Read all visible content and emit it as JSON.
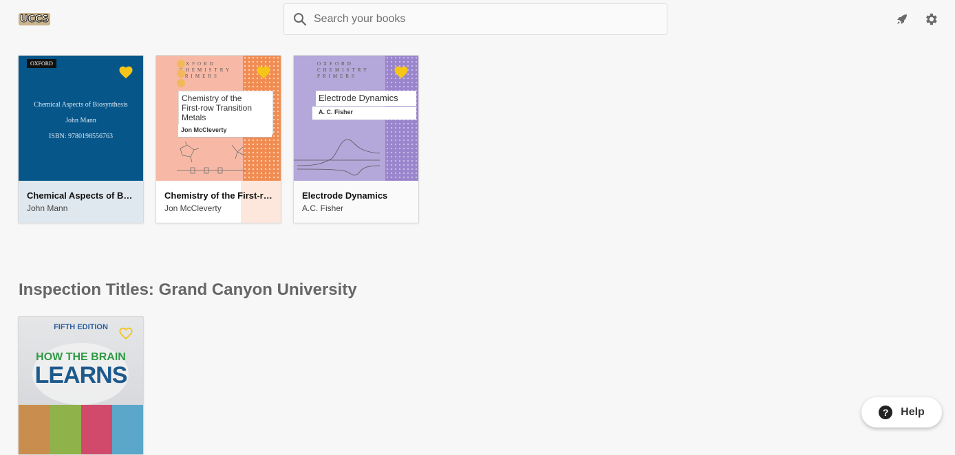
{
  "header": {
    "logo_text": "UCCS",
    "search": {
      "placeholder": "Search your books",
      "value": ""
    },
    "icons": [
      "rocket-icon",
      "gear-icon"
    ]
  },
  "books": [
    {
      "title": "Chemical Aspects of Bio...",
      "author": "John Mann",
      "favorited": true,
      "cover": {
        "publisher": "OXFORD",
        "title": "Chemical Aspects of Biosynthesis",
        "author": "John Mann",
        "isbn": "ISBN: 9780198556763",
        "color": "#06568a"
      },
      "meta_bg": "#dfe8ee"
    },
    {
      "title": "Chemistry of the First-ro...",
      "author": "Jon McCleverty",
      "favorited": true,
      "cover": {
        "series": "OXFORD CHEMISTRY PRIMERS",
        "title_lines": [
          "Chemistry of the",
          "First-row Transition",
          "Metals"
        ],
        "author": "Jon McCleverty",
        "color": "#f7b9a6",
        "accent": "#f08c52"
      },
      "meta_bg": "#ffffff"
    },
    {
      "title": "Electrode Dynamics",
      "author": "A.C. Fisher",
      "favorited": true,
      "cover": {
        "series": "OXFORD CHEMISTRY PRIMERS",
        "title": "Electrode Dynamics",
        "author": "A. C. Fisher",
        "color": "#b4a7d9",
        "accent": "#9a85cc"
      },
      "meta_bg": "#ffffff"
    }
  ],
  "inspection_section": {
    "title": "Inspection Titles: Grand Canyon University",
    "books": [
      {
        "cover": {
          "edition": "FIFTH EDITION",
          "title_line1": "HOW THE BRAIN",
          "title_line2": "LEARNS"
        },
        "favorited": false
      }
    ]
  },
  "help": {
    "label": "Help",
    "icon": "?"
  },
  "colors": {
    "heart": "#f5c518",
    "background": "#f7f7f7",
    "section_title": "#666666"
  }
}
